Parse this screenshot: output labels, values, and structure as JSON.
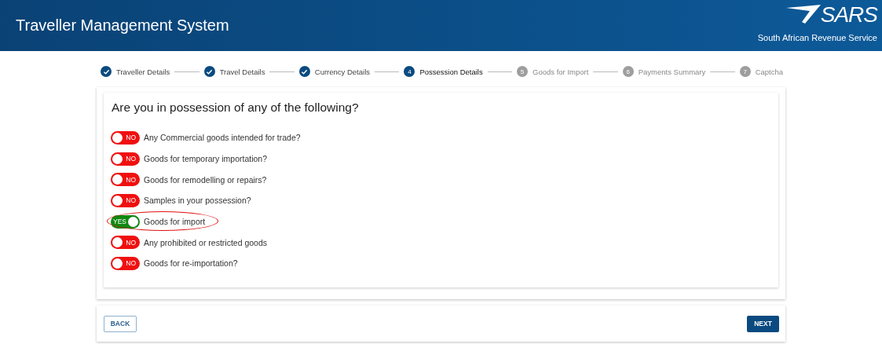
{
  "header": {
    "title": "Traveller Management System",
    "logo_text": "SARS",
    "subtitle": "South African Revenue Service"
  },
  "steps": [
    {
      "label": "Traveller Details",
      "completed": true,
      "active": false
    },
    {
      "label": "Travel Details",
      "completed": true,
      "active": false
    },
    {
      "label": "Currency Details",
      "completed": true,
      "active": false
    },
    {
      "number": "4",
      "label": "Possession Details",
      "completed": false,
      "active": true
    },
    {
      "number": "5",
      "label": "Goods for Import",
      "completed": false,
      "active": false
    },
    {
      "number": "6",
      "label": "Payments Summary",
      "completed": false,
      "active": false
    },
    {
      "number": "7",
      "label": "Captcha",
      "completed": false,
      "active": false
    }
  ],
  "question": "Are you in possession of any of the following?",
  "items": [
    {
      "label": "Any Commercial goods intended for trade?",
      "on": false,
      "toggle_text": "NO",
      "highlighted": false
    },
    {
      "label": "Goods for temporary importation?",
      "on": false,
      "toggle_text": "NO",
      "highlighted": false
    },
    {
      "label": "Goods for remodelling or repairs?",
      "on": false,
      "toggle_text": "NO",
      "highlighted": false
    },
    {
      "label": "Samples in your possession?",
      "on": false,
      "toggle_text": "NO",
      "highlighted": false
    },
    {
      "label": "Goods for import",
      "on": true,
      "toggle_text": "YES",
      "highlighted": true
    },
    {
      "label": "Any prohibited or restricted goods",
      "on": false,
      "toggle_text": "NO",
      "highlighted": false
    },
    {
      "label": "Goods for re-importation?",
      "on": false,
      "toggle_text": "NO",
      "highlighted": false
    }
  ],
  "buttons": {
    "back": "BACK",
    "next": "NEXT"
  }
}
